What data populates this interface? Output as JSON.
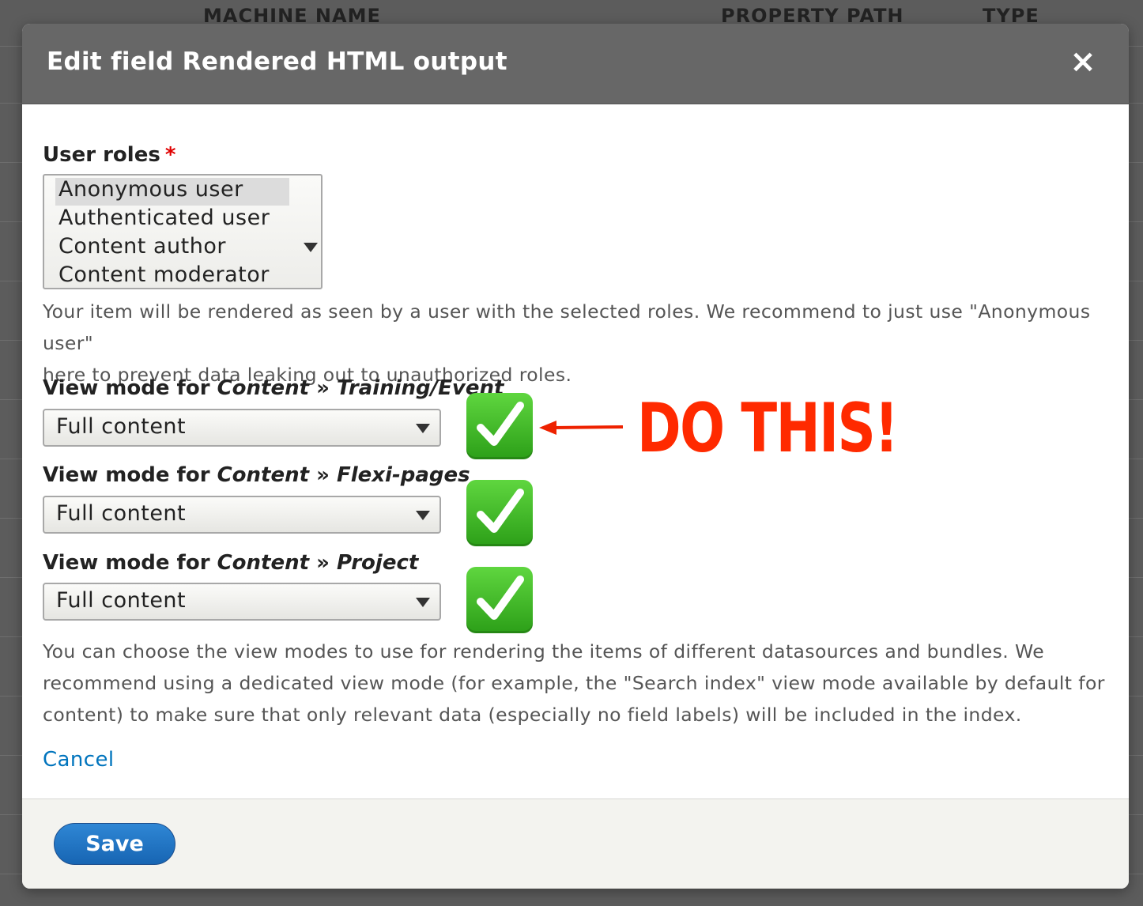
{
  "background": {
    "headers": [
      "MACHINE NAME",
      "PROPERTY PATH",
      "TYPE"
    ]
  },
  "dialog": {
    "title": "Edit field Rendered HTML output",
    "close_label": "×",
    "user_roles": {
      "label": "User roles",
      "required_marker": "*",
      "options": [
        "Anonymous user",
        "Authenticated user",
        "Content author",
        "Content moderator"
      ],
      "selected": "Anonymous user",
      "description_line1": "Your item will be rendered as seen by a user with the selected roles. We recommend to just use \"Anonymous user\"",
      "description_line2": "here to prevent data leaking out to unauthorized roles."
    },
    "view_modes": [
      {
        "prefix": "View mode for ",
        "entity": "Content",
        "sep": " » ",
        "bundle": "Training/Event",
        "value": "Full content"
      },
      {
        "prefix": "View mode for ",
        "entity": "Content",
        "sep": " » ",
        "bundle": "Flexi-pages",
        "value": "Full content"
      },
      {
        "prefix": "View mode for ",
        "entity": "Content",
        "sep": " » ",
        "bundle": "Project",
        "value": "Full content"
      }
    ],
    "view_modes_description": [
      "You can choose the view modes to use for rendering the items of different datasources and bundles. We",
      "recommend using a dedicated view mode (for example, the \"Search index\" view mode available by default for",
      "content) to make sure that only relevant data (especially no field labels) will be included in the index."
    ],
    "cancel_label": "Cancel",
    "save_label": "Save"
  },
  "annotation": {
    "text": "DO THIS!",
    "color": "#ff2a00"
  },
  "colors": {
    "titlebar": "#676767",
    "link": "#0074bd",
    "save_button": "#1f75c4",
    "required": "#e00000",
    "check": "#3bb827"
  }
}
